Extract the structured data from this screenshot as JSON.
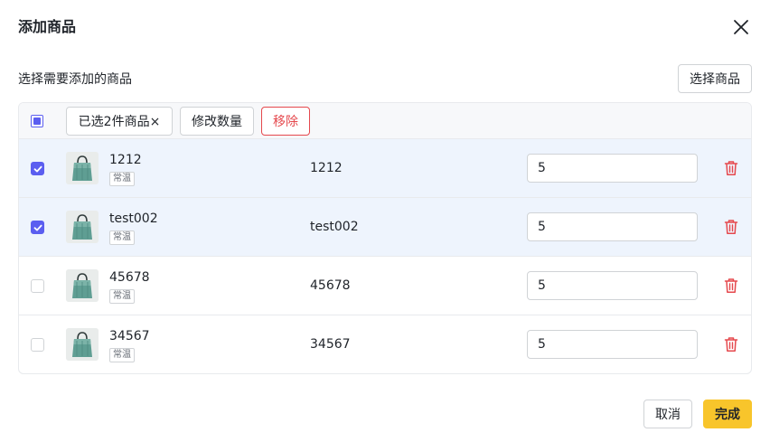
{
  "dialog": {
    "title": "添加商品",
    "subtitle": "选择需要添加的商品",
    "select_button": "选择商品"
  },
  "toolbar": {
    "selected_label": "已选2件商品×",
    "modify_qty_label": "修改数量",
    "remove_label": "移除"
  },
  "rows": [
    {
      "name": "1212",
      "tag": "常温",
      "code": "1212",
      "qty": "5",
      "checked": true
    },
    {
      "name": "test002",
      "tag": "常温",
      "code": "test002",
      "qty": "5",
      "checked": true
    },
    {
      "name": "45678",
      "tag": "常温",
      "code": "45678",
      "qty": "5",
      "checked": false
    },
    {
      "name": "34567",
      "tag": "常温",
      "code": "34567",
      "qty": "5",
      "checked": false
    }
  ],
  "footer": {
    "cancel_label": "取消",
    "done_label": "完成"
  },
  "colors": {
    "accent": "#5b5ef0",
    "danger": "#e5484d",
    "primary_button": "#f8c52b",
    "selected_row": "#eef4fd"
  },
  "icons": {
    "close": "close-icon",
    "trash": "trash-icon",
    "checkbox": "checkmark-icon"
  }
}
